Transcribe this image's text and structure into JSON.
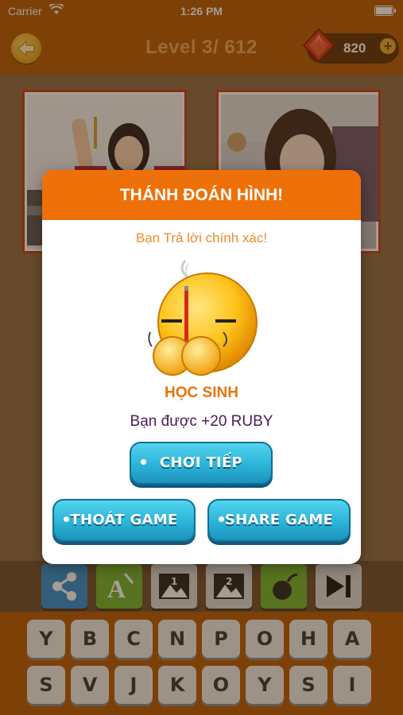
{
  "status_bar": {
    "carrier": "Carrier",
    "time": "1:26 PM"
  },
  "header": {
    "level": "Level 3/ 612",
    "ruby_count": "820",
    "plus": "+"
  },
  "modal": {
    "title": "THÁNH ĐOÁN HÌNH!",
    "subtitle": "Bạn Trả lời chính xác!",
    "answer": "HỌC SINH",
    "reward": "Bạn được +20 RUBY",
    "continue_label": "CHƠI TIẾP",
    "quit_label": "THOÁT GAME",
    "share_label": "SHARE GAME"
  },
  "tools": [
    {
      "name": "share",
      "color": "#2d8fd6"
    },
    {
      "name": "reveal-letter",
      "color": "#6db431"
    },
    {
      "name": "show-picture-1",
      "color": "#d9d9d9"
    },
    {
      "name": "show-picture-2",
      "color": "#d9d9d9"
    },
    {
      "name": "bomb",
      "color": "#6db431"
    },
    {
      "name": "skip",
      "color": "#d9d9d9"
    }
  ],
  "keyboard": {
    "row1": [
      "Y",
      "B",
      "C",
      "N",
      "P",
      "O",
      "H",
      "A"
    ],
    "row2": [
      "S",
      "V",
      "J",
      "K",
      "O",
      "Y",
      "S",
      "I"
    ]
  },
  "colors": {
    "header": "#b35a07",
    "modal_head": "#ee7009",
    "button": "#2bb3d8"
  }
}
